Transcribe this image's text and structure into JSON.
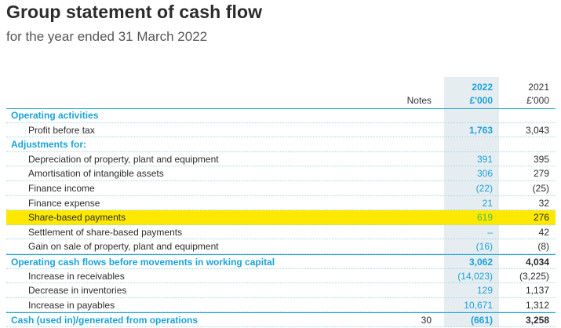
{
  "title": "Group statement of cash flow",
  "subtitle": "for the year ended 31 March 2022",
  "columns": {
    "notes": "Notes",
    "year_2022": "2022",
    "unit_2022": "£'000",
    "year_2021": "2021",
    "unit_2021": "£'000"
  },
  "colors": {
    "accent": "#1aa3d9",
    "highlight": "#fde800",
    "column_shade": "#e6edf1"
  },
  "rows": [
    {
      "label": "Operating activities",
      "note": "",
      "v2022": "",
      "v2021": ""
    },
    {
      "label": "Profit before tax",
      "note": "",
      "v2022": "1,763",
      "v2021": "3,043"
    },
    {
      "label": "Adjustments for:",
      "note": "",
      "v2022": "",
      "v2021": ""
    },
    {
      "label": "Depreciation of property, plant and equipment",
      "note": "",
      "v2022": "391",
      "v2021": "395"
    },
    {
      "label": "Amortisation of intangible assets",
      "note": "",
      "v2022": "306",
      "v2021": "279"
    },
    {
      "label": "Finance income",
      "note": "",
      "v2022": "(22)",
      "v2021": "(25)"
    },
    {
      "label": "Finance expense",
      "note": "",
      "v2022": "21",
      "v2021": "32"
    },
    {
      "label": "Share-based payments",
      "note": "",
      "v2022": "619",
      "v2021": "276"
    },
    {
      "label": "Settlement of share-based payments",
      "note": "",
      "v2022": "–",
      "v2021": "42"
    },
    {
      "label": "Gain on sale of property, plant and equipment",
      "note": "",
      "v2022": "(16)",
      "v2021": "(8)"
    },
    {
      "label": "Operating cash flows before movements in working capital",
      "note": "",
      "v2022": "3,062",
      "v2021": "4,034"
    },
    {
      "label": "Increase in receivables",
      "note": "",
      "v2022": "(14,023)",
      "v2021": "(3,225)"
    },
    {
      "label": "Decrease in inventories",
      "note": "",
      "v2022": "129",
      "v2021": "1,137"
    },
    {
      "label": "Increase in payables",
      "note": "",
      "v2022": "10,671",
      "v2021": "1,312"
    },
    {
      "label": "Cash (used in)/generated from operations",
      "note": "30",
      "v2022": "(661)",
      "v2021": "3,258"
    }
  ]
}
